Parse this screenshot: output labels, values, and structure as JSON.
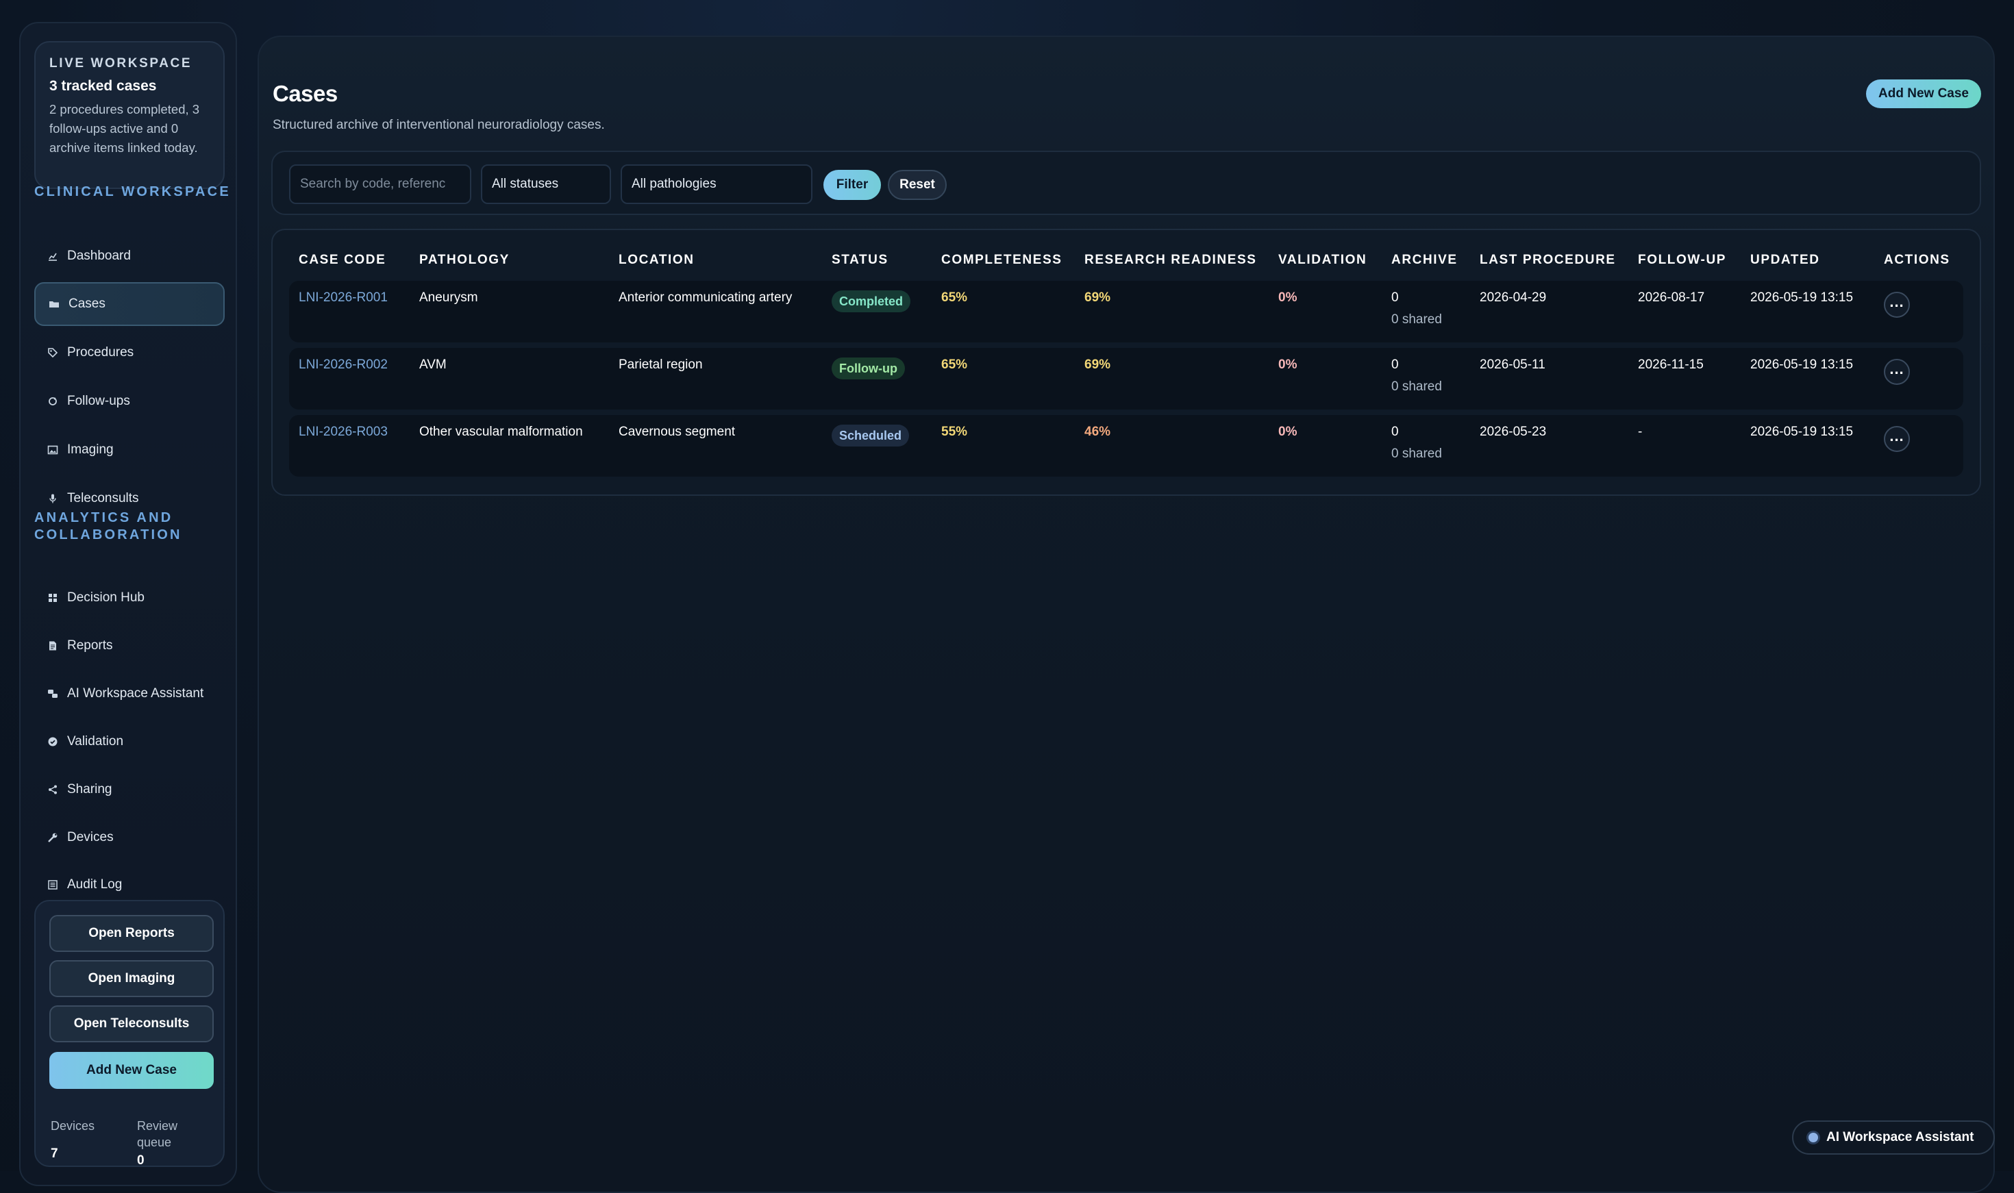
{
  "sidebar": {
    "live": {
      "kicker": "LIVE WORKSPACE",
      "title": "3 tracked cases",
      "description": "2 procedures completed, 3 follow-ups active and 0 archive items linked today."
    },
    "clinical_heading": "CLINICAL WORKSPACE",
    "clinical_items": [
      {
        "label": "Dashboard",
        "icon": "chart-icon"
      },
      {
        "label": "Cases",
        "icon": "folder-icon",
        "active": true
      },
      {
        "label": "Procedures",
        "icon": "tag-icon"
      },
      {
        "label": "Follow-ups",
        "icon": "cycle-icon"
      },
      {
        "label": "Imaging",
        "icon": "image-icon"
      },
      {
        "label": "Teleconsults",
        "icon": "microphone-icon"
      }
    ],
    "analytics_heading": "ANALYTICS AND COLLABORATION",
    "analytics_items": [
      {
        "label": "Decision Hub",
        "icon": "grid-icon"
      },
      {
        "label": "Reports",
        "icon": "document-icon"
      },
      {
        "label": "AI Workspace Assistant",
        "icon": "assistant-icon"
      },
      {
        "label": "Validation",
        "icon": "check-circle-icon"
      },
      {
        "label": "Sharing",
        "icon": "share-icon"
      },
      {
        "label": "Devices",
        "icon": "wrench-icon"
      },
      {
        "label": "Audit Log",
        "icon": "list-icon"
      }
    ],
    "quick_actions": {
      "open_reports": "Open Reports",
      "open_imaging": "Open Imaging",
      "open_teleconsults": "Open Teleconsults",
      "add_new_case": "Add New Case"
    },
    "stats": {
      "devices_label": "Devices",
      "devices_value": "7",
      "review_label": "Review queue",
      "review_value": "0"
    }
  },
  "main": {
    "title": "Cases",
    "subtitle": "Structured archive of interventional neuroradiology cases.",
    "add_button": "Add New Case",
    "filters": {
      "search_placeholder": "Search by code, referenc",
      "status_value": "All statuses",
      "pathology_value": "All pathologies",
      "filter_label": "Filter",
      "reset_label": "Reset"
    },
    "table": {
      "headers": {
        "case_code": "CASE CODE",
        "pathology": "PATHOLOGY",
        "location": "LOCATION",
        "status": "STATUS",
        "completeness": "COMPLETENESS",
        "research_readiness": "RESEARCH READINESS",
        "validation": "VALIDATION",
        "archive": "ARCHIVE",
        "last_procedure": "LAST PROCEDURE",
        "follow_up": "FOLLOW-UP",
        "updated": "UPDATED",
        "actions": "ACTIONS"
      },
      "rows": [
        {
          "code": "LNI-2026-R001",
          "pathology": "Aneurysm",
          "location": "Anterior communicating artery",
          "status": "Completed",
          "completeness": "65%",
          "readiness": "69%",
          "validation": "0%",
          "archive": "0",
          "archive_shared": "0 shared",
          "last_procedure": "2026-04-29",
          "follow_up": "2026-08-17",
          "updated": "2026-05-19 13:15"
        },
        {
          "code": "LNI-2026-R002",
          "pathology": "AVM",
          "location": "Parietal region",
          "status": "Follow-up",
          "completeness": "65%",
          "readiness": "69%",
          "validation": "0%",
          "archive": "0",
          "archive_shared": "0 shared",
          "last_procedure": "2026-05-11",
          "follow_up": "2026-11-15",
          "updated": "2026-05-19 13:15"
        },
        {
          "code": "LNI-2026-R003",
          "pathology": "Other vascular malformation",
          "location": "Cavernous segment",
          "status": "Scheduled",
          "completeness": "55%",
          "readiness": "46%",
          "validation": "0%",
          "archive": "0",
          "archive_shared": "0 shared",
          "last_procedure": "2026-05-23",
          "follow_up": "-",
          "updated": "2026-05-19 13:15"
        }
      ]
    }
  },
  "assistant_pill": "AI Workspace Assistant",
  "colors": {
    "accent": "#7fc4ee",
    "accent_teal": "#6cd6c8",
    "link": "#7ca8d8",
    "completed": "#86e6c8",
    "followup": "#a3e9a6",
    "scheduled": "#a8c8f0"
  }
}
